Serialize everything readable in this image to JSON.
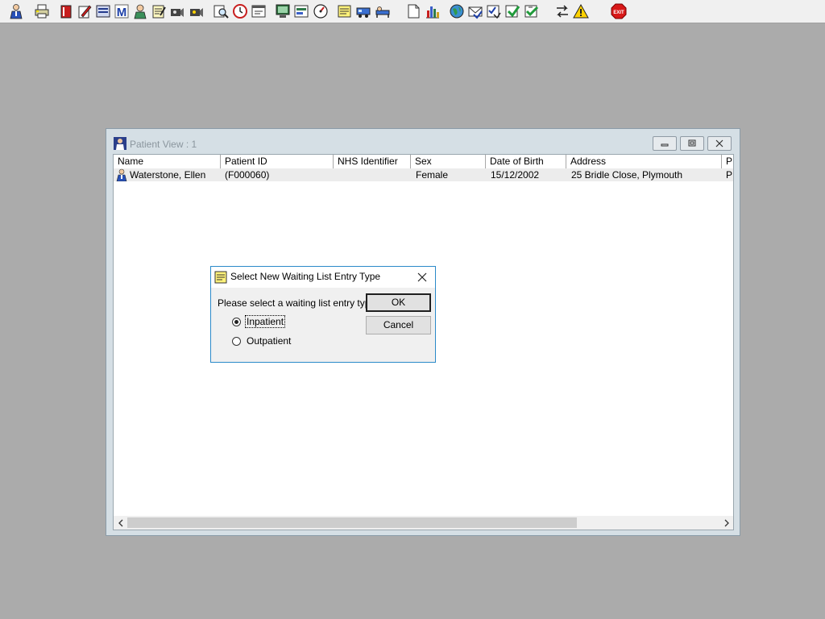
{
  "toolbar": {
    "buttons": [
      {
        "name": "patient-icon"
      },
      {
        "name": "printer-icon"
      },
      {
        "name": "red-book-icon"
      },
      {
        "name": "edit-notes-icon"
      },
      {
        "name": "scan-icon"
      },
      {
        "name": "m-letter-icon"
      },
      {
        "name": "doctor-icon"
      },
      {
        "name": "notepad-icon"
      },
      {
        "name": "camera-icon"
      },
      {
        "name": "camera-2-icon"
      },
      {
        "name": "magnifier-icon"
      },
      {
        "name": "clock-icon"
      },
      {
        "name": "window-icon"
      },
      {
        "name": "monitor-icon"
      },
      {
        "name": "document-chart-icon"
      },
      {
        "name": "gauge-icon"
      },
      {
        "name": "list-icon"
      },
      {
        "name": "transport-icon"
      },
      {
        "name": "bed-icon"
      },
      {
        "name": "blank-page-icon"
      },
      {
        "name": "bar-chart-icon"
      },
      {
        "name": "globe-icon"
      },
      {
        "name": "mail-icon"
      },
      {
        "name": "checklist-icon"
      },
      {
        "name": "green-arrow-icon"
      },
      {
        "name": "green-check-icon"
      },
      {
        "name": "swap-icon"
      },
      {
        "name": "warning-icon"
      },
      {
        "name": "exit-icon"
      }
    ],
    "exit_label": "EXIT"
  },
  "patient_window": {
    "title": "Patient View : 1",
    "columns": [
      "Name",
      "Patient ID",
      "NHS Identifier",
      "Sex",
      "Date of Birth",
      "Address",
      "P"
    ],
    "rows": [
      {
        "name": "Waterstone, Ellen",
        "patient_id": "(F000060)",
        "nhs_identifier": "",
        "sex": "Female",
        "date_of_birth": "15/12/2002",
        "address": "25 Bridle Close, Plymouth",
        "p": "P"
      }
    ]
  },
  "dialog": {
    "title": "Select New Waiting List Entry Type",
    "prompt": "Please select a waiting list entry type",
    "options": [
      {
        "label": "Inpatient",
        "selected": true
      },
      {
        "label": "Outpatient",
        "selected": false
      }
    ],
    "ok_label": "OK",
    "cancel_label": "Cancel"
  },
  "colors": {
    "desktop": "#ababab",
    "dialog_border": "#2b8ac9",
    "row_highlight": "#ececec"
  }
}
